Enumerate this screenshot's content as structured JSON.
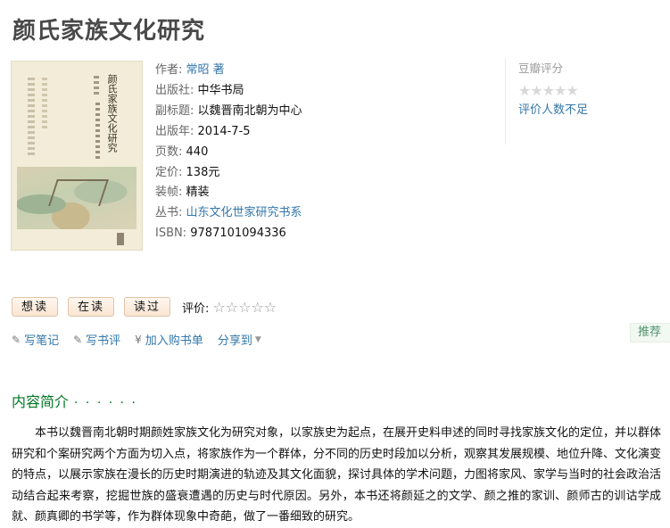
{
  "book": {
    "title": "颜氏家族文化研究",
    "cover_title": "颜氏家族文化研究",
    "info": [
      {
        "label": "作者:",
        "value": "常昭 著",
        "link": true
      },
      {
        "label": "出版社:",
        "value": "中华书局",
        "link": false
      },
      {
        "label": "副标题:",
        "value": "以魏晋南北朝为中心",
        "link": false
      },
      {
        "label": "出版年:",
        "value": "2014-7-5",
        "link": false
      },
      {
        "label": "页数:",
        "value": "440",
        "link": false
      },
      {
        "label": "定价:",
        "value": "138元",
        "link": false
      },
      {
        "label": "装帧:",
        "value": "精装",
        "link": false
      },
      {
        "label": "丛书:",
        "value": "山东文化世家研究书系",
        "link": true
      },
      {
        "label": "ISBN:",
        "value": "9787101094336",
        "link": false
      }
    ]
  },
  "rating_panel": {
    "title": "豆瓣评分",
    "stars": "★★★★★",
    "note": "评价人数不足"
  },
  "actions": {
    "want_read": "想读",
    "reading": "在读",
    "read": "读过",
    "my_rating_label": "评价:",
    "my_rating_stars": "☆☆☆☆☆"
  },
  "sub_actions": {
    "write_note": "写笔记",
    "write_review": "写书评",
    "add_cart": "加入购书单",
    "share": "分享到",
    "recommend": "推荐"
  },
  "intro": {
    "heading": "内容简介",
    "dots": "· · · · · ·",
    "text": "本书以魏晋南北朝时期颜姓家族文化为研究对象，以家族史为起点，在展开史料申述的同时寻找家族文化的定位，并以群体研究和个案研究两个方面为切入点，将家族作为一个群体，分不同的历史时段加以分析，观察其发展规模、地位升降、文化演变的特点，以展示家族在漫长的历史时期演进的轨迹及其文化面貌，探讨具体的学术问题，力图将家风、家学与当时的社会政治活动结合起来考察，挖掘世族的盛衰遭遇的历史与时代原因。另外，本书还将颜延之的文学、颜之推的家训、颜师古的训诂学成就、颜真卿的书学等，作为群体现象中奇葩，做了一番细致的研究。"
  }
}
